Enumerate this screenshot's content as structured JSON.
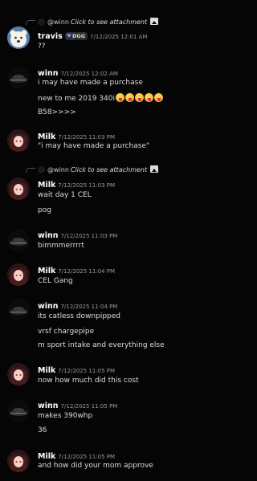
{
  "messages": [
    {
      "reply": {
        "author": "@winn",
        "text": "Click to see attachment",
        "icon": "image-icon"
      },
      "author": "travis",
      "badge": "DGG",
      "timestamp": "7/12/2025 12:01 AM",
      "lines": [
        "??"
      ]
    },
    {
      "author": "winn",
      "timestamp": "7/12/2025 12:02 AM",
      "lines": [
        "i may have made a purchase",
        "new to me 2019 340i",
        "B58>>>>"
      ],
      "emoji": {
        "name": "tongue-out-emoji",
        "count": 5
      }
    },
    {
      "author": "Milk",
      "timestamp": "7/12/2025 11:03 PM",
      "lines": [
        "\"i may have made a purchase\""
      ]
    },
    {
      "reply": {
        "author": "@winn",
        "text": "Click to see attachment",
        "icon": "image-icon"
      },
      "author": "Milk",
      "timestamp": "7/12/2025 11:03 PM",
      "lines": [
        "wait day 1 CEL",
        "pog"
      ]
    },
    {
      "author": "winn",
      "timestamp": "7/12/2025 11:03 PM",
      "lines": [
        "bimmmerrrrt"
      ]
    },
    {
      "author": "Milk",
      "timestamp": "7/12/2025 11:04 PM",
      "lines": [
        "CEL Gang"
      ]
    },
    {
      "author": "winn",
      "timestamp": "7/12/2025 11:04 PM",
      "lines": [
        "its catless downpipped",
        "vrsf chargepipe",
        "m sport intake and everything else"
      ]
    },
    {
      "author": "Milk",
      "timestamp": "7/12/2025 11:05 PM",
      "lines": [
        "now how much did this cost"
      ]
    },
    {
      "author": "winn",
      "timestamp": "7/12/2025 11:05 PM",
      "lines": [
        "makes 390whp",
        "36"
      ]
    },
    {
      "author": "Milk",
      "timestamp": "7/12/2025 11:05 PM",
      "lines": [
        "and how did your mom approve"
      ]
    }
  ]
}
